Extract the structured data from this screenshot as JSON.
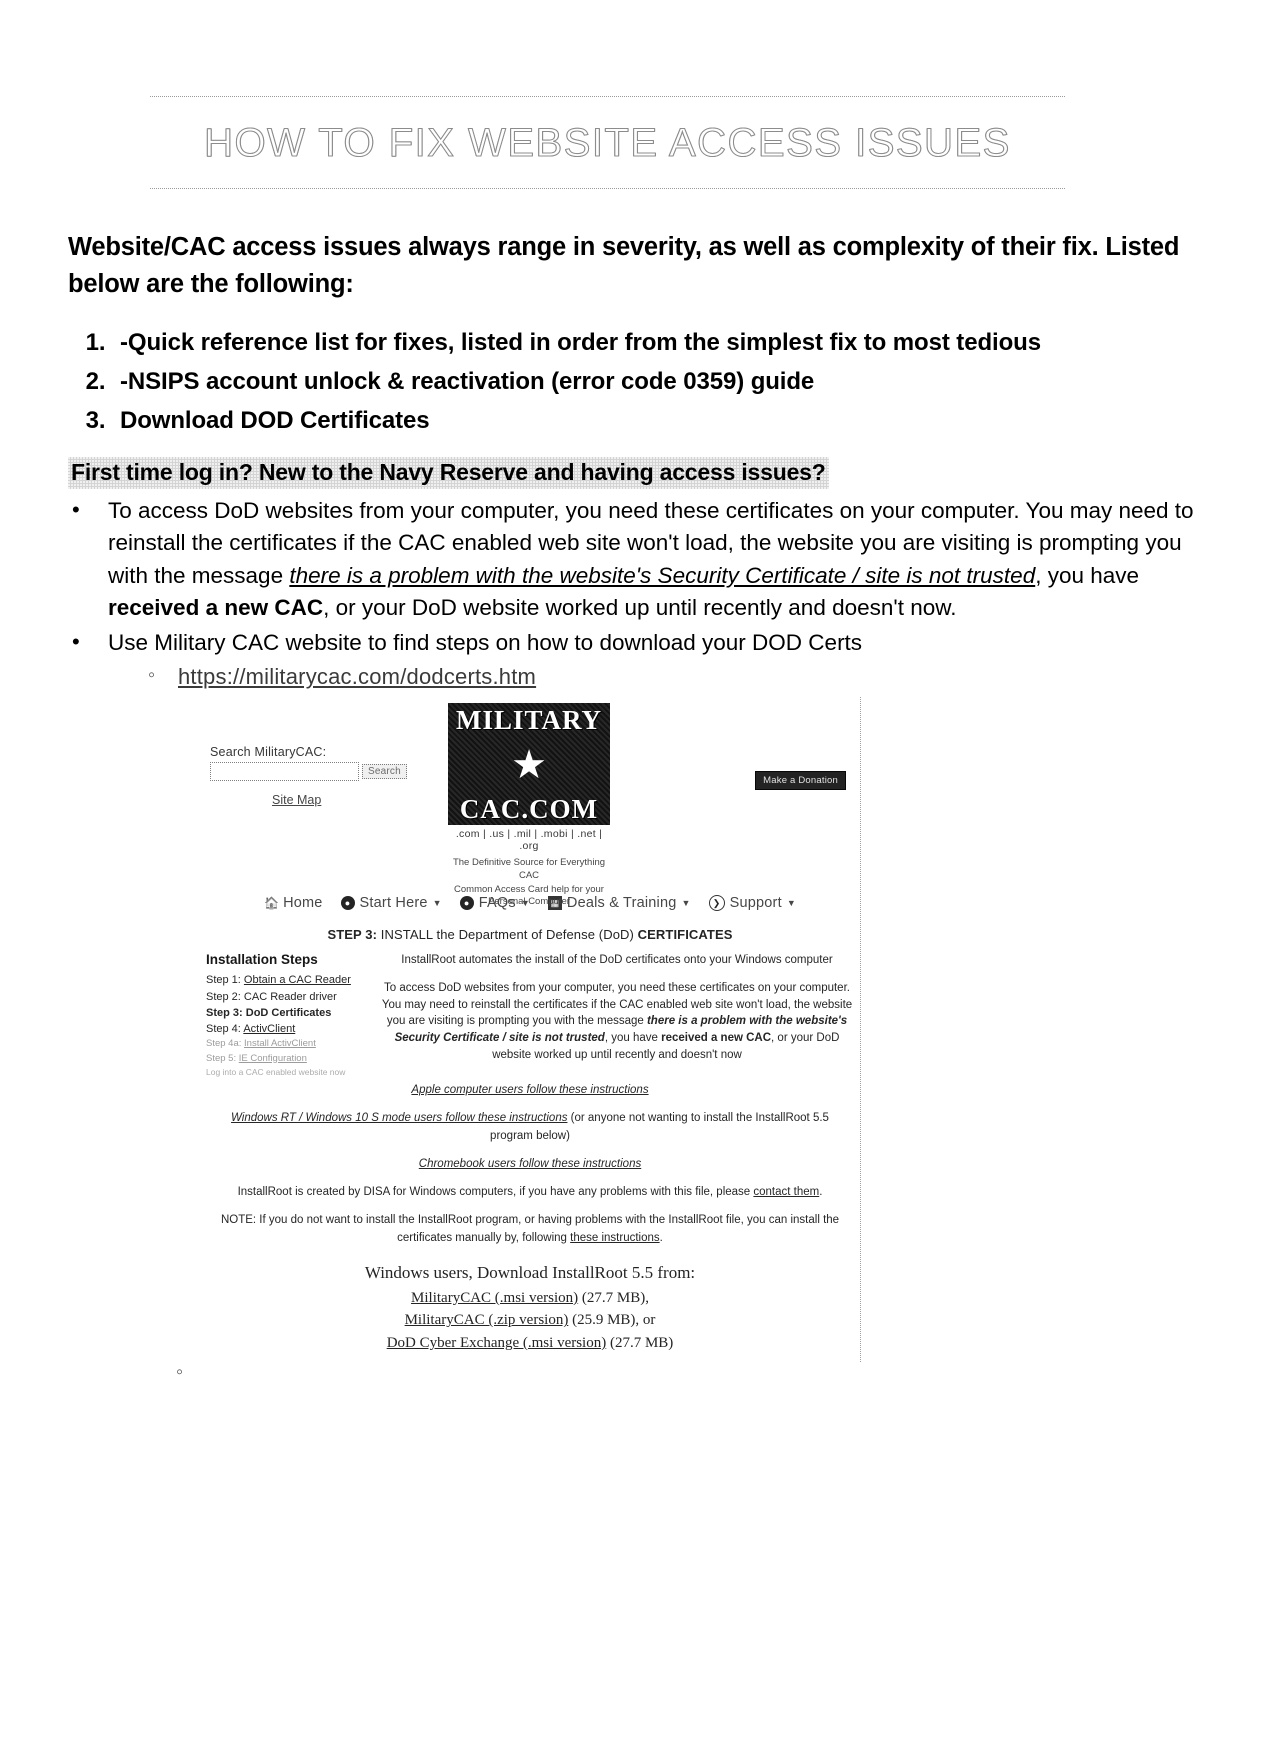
{
  "document": {
    "title": "HOW TO FIX WEBSITE ACCESS ISSUES",
    "intro": "Website/CAC access issues always range in severity, as well as complexity of their fix. Listed below are the following:",
    "numbered_list": [
      "-Quick reference list for fixes, listed in order from the simplest fix to most tedious",
      "-NSIPS account unlock & reactivation (error code 0359) guide",
      "Download DOD Certificates"
    ],
    "highlighted_heading": "First time log in? New to the Navy Reserve and having access issues?",
    "bullets": {
      "first": {
        "part1": "To access DoD websites from your computer, you need these certificates on your computer. You may need to reinstall the certificates if the CAC enabled web site won't load, the website you are visiting is prompting you with the message ",
        "italic_underline": "there is a problem with the website's Security Certificate / site is not trusted",
        "part2": ", you have ",
        "bold": "received a new CAC",
        "part3": ", or your DoD website worked up until recently and doesn't now."
      },
      "second": "Use Military CAC website to find steps on how to download your DOD Certs",
      "sub_link": "https://militarycac.com/dodcerts.htm"
    }
  },
  "screenshot": {
    "search": {
      "label": "Search MilitaryCAC:",
      "input_value": "",
      "placeholder": "",
      "button_label": "Search"
    },
    "site_map_label": "Site Map",
    "logo": {
      "line1": "MILITARY",
      "star": "★",
      "line2": "CAC.COM",
      "tlds": ".com | .us | .mil | .mobi | .net | .org",
      "tagline_1": "The Definitive Source for Everything CAC",
      "tagline_2": "Common Access Card help for your",
      "tagline_3": "Personal Computer"
    },
    "donate_label": "Make a Donation",
    "nav": [
      {
        "label": "Home",
        "icon": "home-icon",
        "caret": false
      },
      {
        "label": "Start Here",
        "icon": "disc-icon",
        "caret": true
      },
      {
        "label": "FAQs",
        "icon": "disc-icon",
        "caret": true
      },
      {
        "label": "Deals & Training",
        "icon": "grid-icon",
        "caret": true
      },
      {
        "label": "Support",
        "icon": "circle-arrow-icon",
        "caret": true
      }
    ],
    "step3_prefix": "STEP 3:",
    "step3_mid": " INSTALL the Department of Defense (DoD) ",
    "step3_suffix": "CERTIFICATES",
    "installation": {
      "heading": "Installation Steps",
      "steps": [
        {
          "label": "Step 1:",
          "value": "Obtain a CAC Reader",
          "underline": true,
          "faint": 0
        },
        {
          "label": "Step 2:",
          "value": "CAC Reader driver",
          "underline": false,
          "faint": 0
        },
        {
          "label": "Step 3:",
          "value": "DoD Certificates",
          "underline": false,
          "faint": 0
        },
        {
          "label": "Step 4:",
          "value": "ActivClient",
          "underline": true,
          "faint": 0
        },
        {
          "label": "Step 4a:",
          "value": "Install ActivClient",
          "underline": true,
          "faint": 1
        },
        {
          "label": "Step 5:",
          "value": "IE Configuration",
          "underline": true,
          "faint": 1
        },
        {
          "label": "Log into a CAC enabled website now",
          "value": "",
          "underline": false,
          "faint": 2
        }
      ]
    },
    "descriptions": {
      "installroot_auto": "InstallRoot automates the install of the DoD certificates onto your Windows computer",
      "access_p1": "To access DoD websites from your computer, you need these certificates on your computer.  You may need to reinstall the certificates if the CAC enabled web site won't load, the website you are visiting is prompting you with the message ",
      "access_bi": "there is a problem with the website's Security Certificate / site is not trusted",
      "access_p2": ", you have ",
      "access_bb": "received a new CAC",
      "access_p3": ", or your DoD website worked up until recently and doesn't now"
    },
    "notes": {
      "apple": "Apple computer users follow these instructions",
      "windows_rt_link": "Windows RT / Windows 10 S mode users follow these instructions",
      "windows_rt_rest": " (or anyone not wanting to install the InstallRoot 5.5 program below)",
      "chromebook": "Chromebook users follow these instructions",
      "disa_pre": "InstallRoot is created by DISA for Windows computers, if you have any problems with this file, please ",
      "disa_link": "contact them",
      "disa_post": ".",
      "note_pre": "NOTE: If you do not want to install the InstallRoot program, or having problems with the InstallRoot file, you can install the certificates manually by, following ",
      "note_link": "these instructions",
      "note_post": "."
    },
    "downloads": {
      "heading": "Windows users, Download InstallRoot 5.5 from:",
      "items": [
        {
          "link": "MilitaryCAC (.msi version)",
          "size": " (27.7 MB),"
        },
        {
          "link": "MilitaryCAC (.zip version)",
          "size": " (25.9 MB), or"
        },
        {
          "link": "DoD Cyber Exchange (.msi version)",
          "size": " (27.7 MB)"
        }
      ]
    }
  }
}
